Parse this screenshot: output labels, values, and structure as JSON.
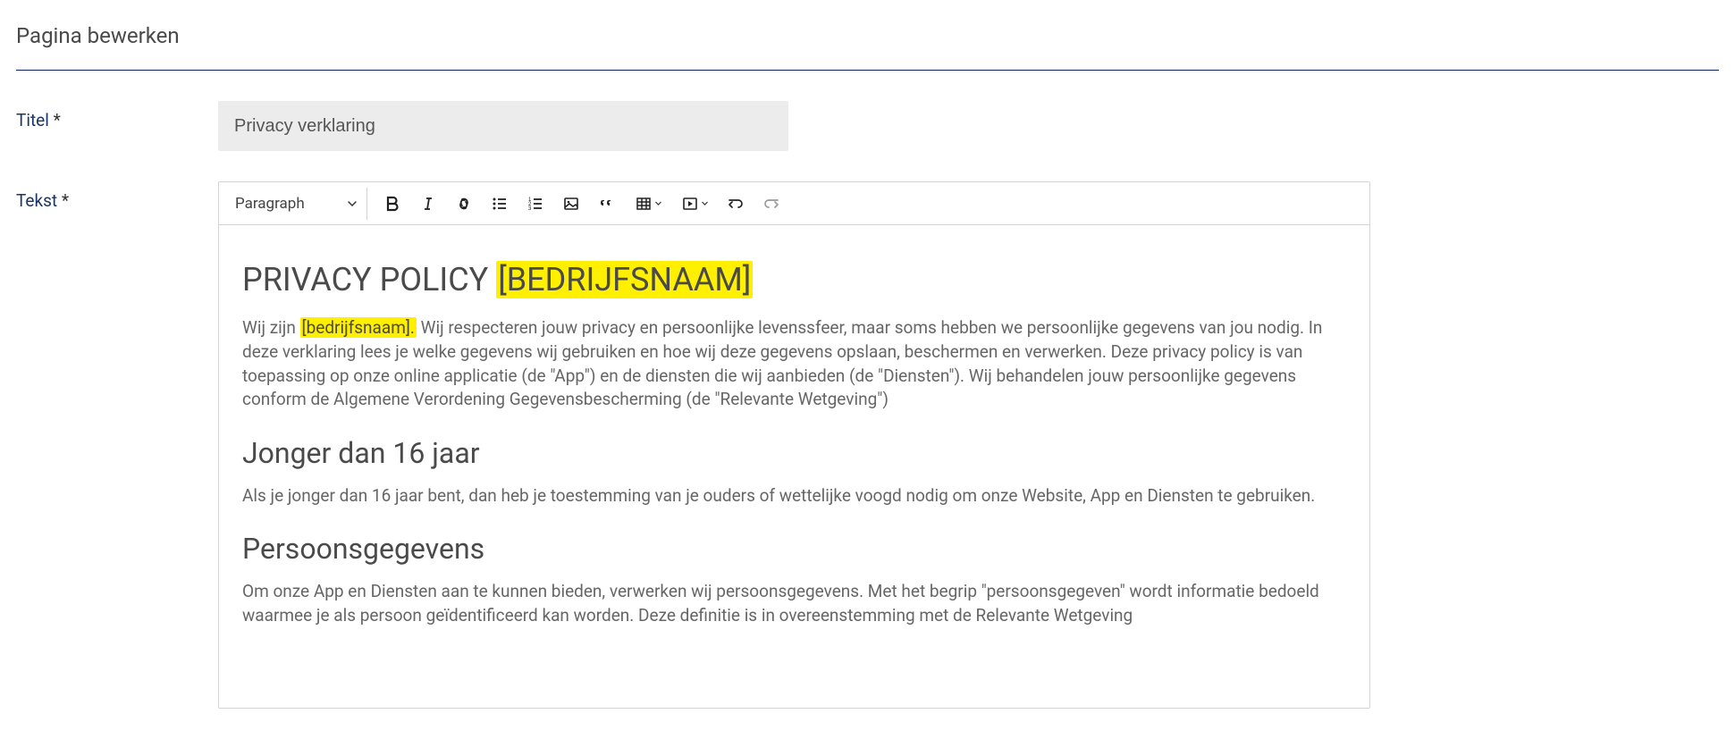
{
  "header": {
    "page_title": "Pagina bewerken"
  },
  "form": {
    "title_label": "Titel",
    "title_required": "*",
    "title_value": "Privacy verklaring",
    "text_label": "Tekst",
    "text_required": "*"
  },
  "toolbar": {
    "block_select": "Paragraph"
  },
  "content": {
    "h1_prefix": "PRIVACY POLICY ",
    "h1_highlight": "[BEDRIJFSNAAM]",
    "p1_a": "Wij zijn ",
    "p1_hl": "[bedrijfsnaam].",
    "p1_b": " Wij respecteren jouw privacy en persoonlijke levenssfeer, maar soms hebben we persoonlijke gegevens van jou nodig. In deze verklaring lees je welke gegevens wij gebruiken en hoe wij deze gegevens opslaan, beschermen en verwerken. Deze privacy policy is van toepassing op onze online applicatie (de \"App\") en de diensten die wij aanbieden (de \"Diensten\"). Wij behandelen jouw persoonlijke gegevens conform de Algemene Verordening Gegevensbescherming (de \"Relevante Wetgeving\")",
    "h2_a": "Jonger dan 16 jaar",
    "p2": "Als je jonger dan 16 jaar bent, dan heb je toestemming van je ouders of wettelijke voogd nodig om onze Website, App en Diensten te gebruiken.",
    "h2_b": "Persoonsgegevens",
    "p3": "Om onze App en Diensten aan te kunnen bieden, verwerken wij persoonsgegevens. Met het begrip \"persoonsgegeven\" wordt informatie bedoeld waarmee je als persoon geïdentificeerd kan worden. Deze definitie is in overeenstemming met de Relevante Wetgeving"
  }
}
